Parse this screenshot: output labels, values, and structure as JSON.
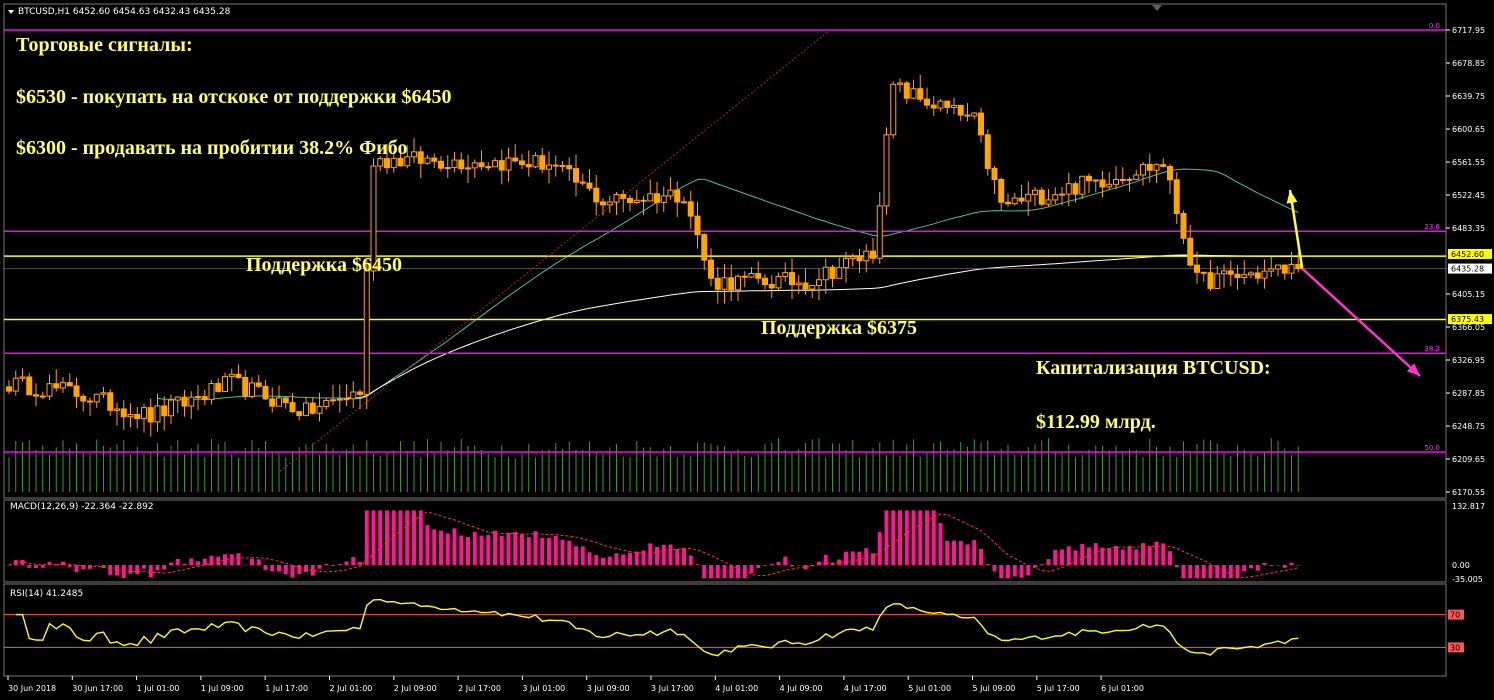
{
  "header": {
    "main_label": "BTCUSD,H1  6452.60 6454.63 6432.43 6435.28",
    "macd_label": "MACD(12,26,9) -22.364 -22.892",
    "rsi_label": "RSI(14) 41.2485"
  },
  "annotations": {
    "signals_title": "Торговые сигналы:",
    "signal_buy": "$6530 - покупать на отскоке от поддержки $6450",
    "signal_sell": "$6300 - продавать на пробитии 38.2% Фибо",
    "support_6450": "Поддержка $6450",
    "support_6375": "Поддержка $6375",
    "cap_title": "Капитализация BTCUSD:",
    "cap_value": "$112.99 млрд."
  },
  "colors": {
    "background": "#000000",
    "candle": "#ffa500",
    "fib_lines": "#ff00ff",
    "support_lines": "#ffff00",
    "ma_fast": "#40c0a0",
    "ma_slow": "#ffffff",
    "volume": "#3a9a3a",
    "macd_hist": "#ff1493",
    "macd_signal": "#ff3030",
    "rsi_line": "#ffff00",
    "rsi_levels": "#ff5555",
    "arrow_up": "#ffff33",
    "arrow_down": "#ff33cc"
  },
  "chart_data": [
    {
      "type": "candlestick",
      "symbol": "BTCUSD",
      "timeframe": "H1",
      "ylim": [
        6170.55,
        6717.95
      ],
      "y_ticks": [
        "6717.95",
        "6678.85",
        "6639.75",
        "6600.65",
        "6561.55",
        "6522.45",
        "6483.35",
        "6405.15",
        "6366.05",
        "6326.95",
        "6287.85",
        "6248.75",
        "6209.65",
        "6170.55"
      ],
      "x_ticks": [
        "30 Jun 2018",
        "30 Jun 17:00",
        "1 Jul 01:00",
        "1 Jul 09:00",
        "1 Jul 17:00",
        "2 Jul 01:00",
        "2 Jul 09:00",
        "2 Jul 17:00",
        "3 Jul 01:00",
        "3 Jul 09:00",
        "3 Jul 17:00",
        "4 Jul 01:00",
        "4 Jul 09:00",
        "4 Jul 17:00",
        "5 Jul 01:00",
        "5 Jul 09:00",
        "5 Jul 17:00",
        "6 Jul 01:00"
      ],
      "current_price": 6435.28,
      "price_tags": [
        {
          "label": "6452.60",
          "value": 6452.6,
          "color": "#ffff00"
        },
        {
          "label": "6435.28",
          "value": 6435.28,
          "color": "#ffffff"
        },
        {
          "label": "6375.43",
          "value": 6375.43,
          "color": "#ffff00"
        }
      ],
      "support_levels": [
        6450,
        6375
      ],
      "fib_levels": [
        {
          "label": "0.0",
          "value": 6717.95
        },
        {
          "label": "23.6",
          "value": 6479.5
        },
        {
          "label": "38.2",
          "value": 6335.0
        },
        {
          "label": "50.0",
          "value": 6218.0
        }
      ],
      "segments": [
        {
          "from": 6300,
          "to": 6290,
          "n": 10
        },
        {
          "from": 6290,
          "to": 6260,
          "n": 12
        },
        {
          "from": 6260,
          "to": 6300,
          "n": 12
        },
        {
          "from": 6300,
          "to": 6265,
          "n": 11
        },
        {
          "from": 6265,
          "to": 6290,
          "n": 8
        },
        {
          "from": 6290,
          "to": 6565,
          "n": 2
        },
        {
          "from": 6565,
          "to": 6560,
          "n": 26
        },
        {
          "from": 6560,
          "to": 6515,
          "n": 8
        },
        {
          "from": 6515,
          "to": 6525,
          "n": 12
        },
        {
          "from": 6525,
          "to": 6420,
          "n": 4
        },
        {
          "from": 6420,
          "to": 6420,
          "n": 14
        },
        {
          "from": 6420,
          "to": 6455,
          "n": 10
        },
        {
          "from": 6455,
          "to": 6650,
          "n": 3
        },
        {
          "from": 6650,
          "to": 6610,
          "n": 12
        },
        {
          "from": 6610,
          "to": 6510,
          "n": 4
        },
        {
          "from": 6510,
          "to": 6560,
          "n": 24
        },
        {
          "from": 6560,
          "to": 6420,
          "n": 5
        },
        {
          "from": 6420,
          "to": 6435,
          "n": 14
        }
      ]
    },
    {
      "type": "bar",
      "name": "MACD(12,26,9)",
      "ylim": [
        -35.005,
        132.817
      ],
      "y_ticks": [
        "132.817",
        "0.00",
        "-35.005"
      ],
      "last_main": -22.364,
      "last_signal": -22.892
    },
    {
      "type": "line",
      "name": "RSI(14)",
      "ylim": [
        0,
        100
      ],
      "levels": [
        70,
        30
      ],
      "y_ticks": [
        "70",
        "30"
      ],
      "last": 41.2485
    }
  ]
}
